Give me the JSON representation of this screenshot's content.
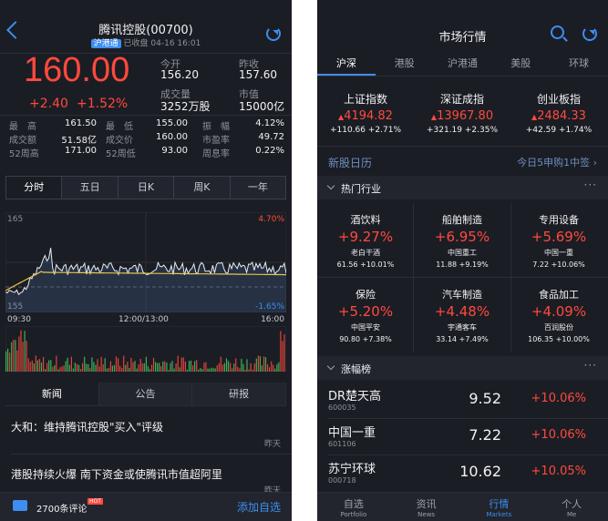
{
  "left": {
    "header": {
      "title": "腾讯控股(00700)",
      "badge": "沪港通",
      "status": "已收盘",
      "time": "04-16 16:01"
    },
    "quote": {
      "price": "160.00",
      "change": "+2.40",
      "change_pct": "+1.52%",
      "open_label": "今开",
      "open": "156.20",
      "prev_label": "昨收",
      "prev": "157.60",
      "vol_label": "成交量",
      "vol": "3252万股",
      "mcap_label": "市值",
      "mcap": "15000亿"
    },
    "stats": [
      [
        "最　高",
        "161.50",
        "最　低",
        "155.00",
        "振　幅",
        "4.12%"
      ],
      [
        "成交额",
        "51.58亿",
        "成交价",
        "160.00",
        "市盈率",
        "49.72"
      ],
      [
        "52周高",
        "171.00",
        "52周低",
        "93.00",
        "周息率",
        "0.22%"
      ]
    ],
    "chart_tabs": [
      "分时",
      "五日",
      "日K",
      "周K",
      "一年"
    ],
    "chart": {
      "top_left": "165",
      "top_right": "4.70%",
      "bottom_left": "155",
      "bottom_right": "-1.65%",
      "t_start": "09:30",
      "t_mid": "12:00/13:00",
      "t_end": "16:00"
    },
    "news_tabs": [
      "新闻",
      "公告",
      "研报"
    ],
    "news": [
      {
        "title": "大和：维持腾讯控股\"买入\"评级",
        "date": "昨天"
      },
      {
        "title": "港股持续火爆 南下资金或使腾讯市值超阿里",
        "date": "昨天"
      }
    ],
    "bottom": {
      "comments": "2700条评论",
      "hot": "HOT",
      "add": "添加自选"
    }
  },
  "right": {
    "title": "市场行情",
    "tabs": [
      "沪深",
      "港股",
      "沪港通",
      "美股",
      "环球"
    ],
    "indices": [
      {
        "name": "上证指数",
        "price": "4194.82",
        "chg": "+110.66",
        "pct": "+2.71%"
      },
      {
        "name": "深证成指",
        "price": "13967.80",
        "chg": "+321.19",
        "pct": "+2.35%"
      },
      {
        "name": "创业板指",
        "price": "2484.33",
        "chg": "+42.59",
        "pct": "+1.74%"
      }
    ],
    "ipo": {
      "label": "新股日历",
      "info": "今日5申购1中签"
    },
    "hot_title": "热门行业",
    "industries": [
      {
        "name": "酒饮料",
        "pct": "+9.27%",
        "stock": "老白干酒",
        "line": "61.56 +10.01%"
      },
      {
        "name": "船舶制造",
        "pct": "+6.95%",
        "stock": "中国重工",
        "line": "11.88 +9.19%"
      },
      {
        "name": "专用设备",
        "pct": "+5.69%",
        "stock": "中国一重",
        "line": "7.22 +10.06%"
      },
      {
        "name": "保险",
        "pct": "+5.20%",
        "stock": "中国平安",
        "line": "90.80 +7.38%"
      },
      {
        "name": "汽车制造",
        "pct": "+4.48%",
        "stock": "宇通客车",
        "line": "33.14 +7.49%"
      },
      {
        "name": "食品加工",
        "pct": "+4.09%",
        "stock": "百润股份",
        "line": "106.35 +10.00%"
      }
    ],
    "gainers_title": "涨幅榜",
    "gainers": [
      {
        "name": "DR楚天高",
        "code": "600035",
        "price": "9.52",
        "pct": "+10.06%"
      },
      {
        "name": "中国一重",
        "code": "601106",
        "price": "7.22",
        "pct": "+10.06%"
      },
      {
        "name": "苏宁环球",
        "code": "000718",
        "price": "10.62",
        "pct": "+10.05%"
      }
    ],
    "nav": [
      {
        "cn": "自选",
        "en": "Portfolio"
      },
      {
        "cn": "资讯",
        "en": "News"
      },
      {
        "cn": "行情",
        "en": "Markets"
      },
      {
        "cn": "个人",
        "en": "Me"
      }
    ]
  },
  "colors": {
    "up": "#ff4a3d",
    "accent": "#3d8ef0",
    "bg": "#1b1d24",
    "avg_line": "#e6c54a"
  }
}
